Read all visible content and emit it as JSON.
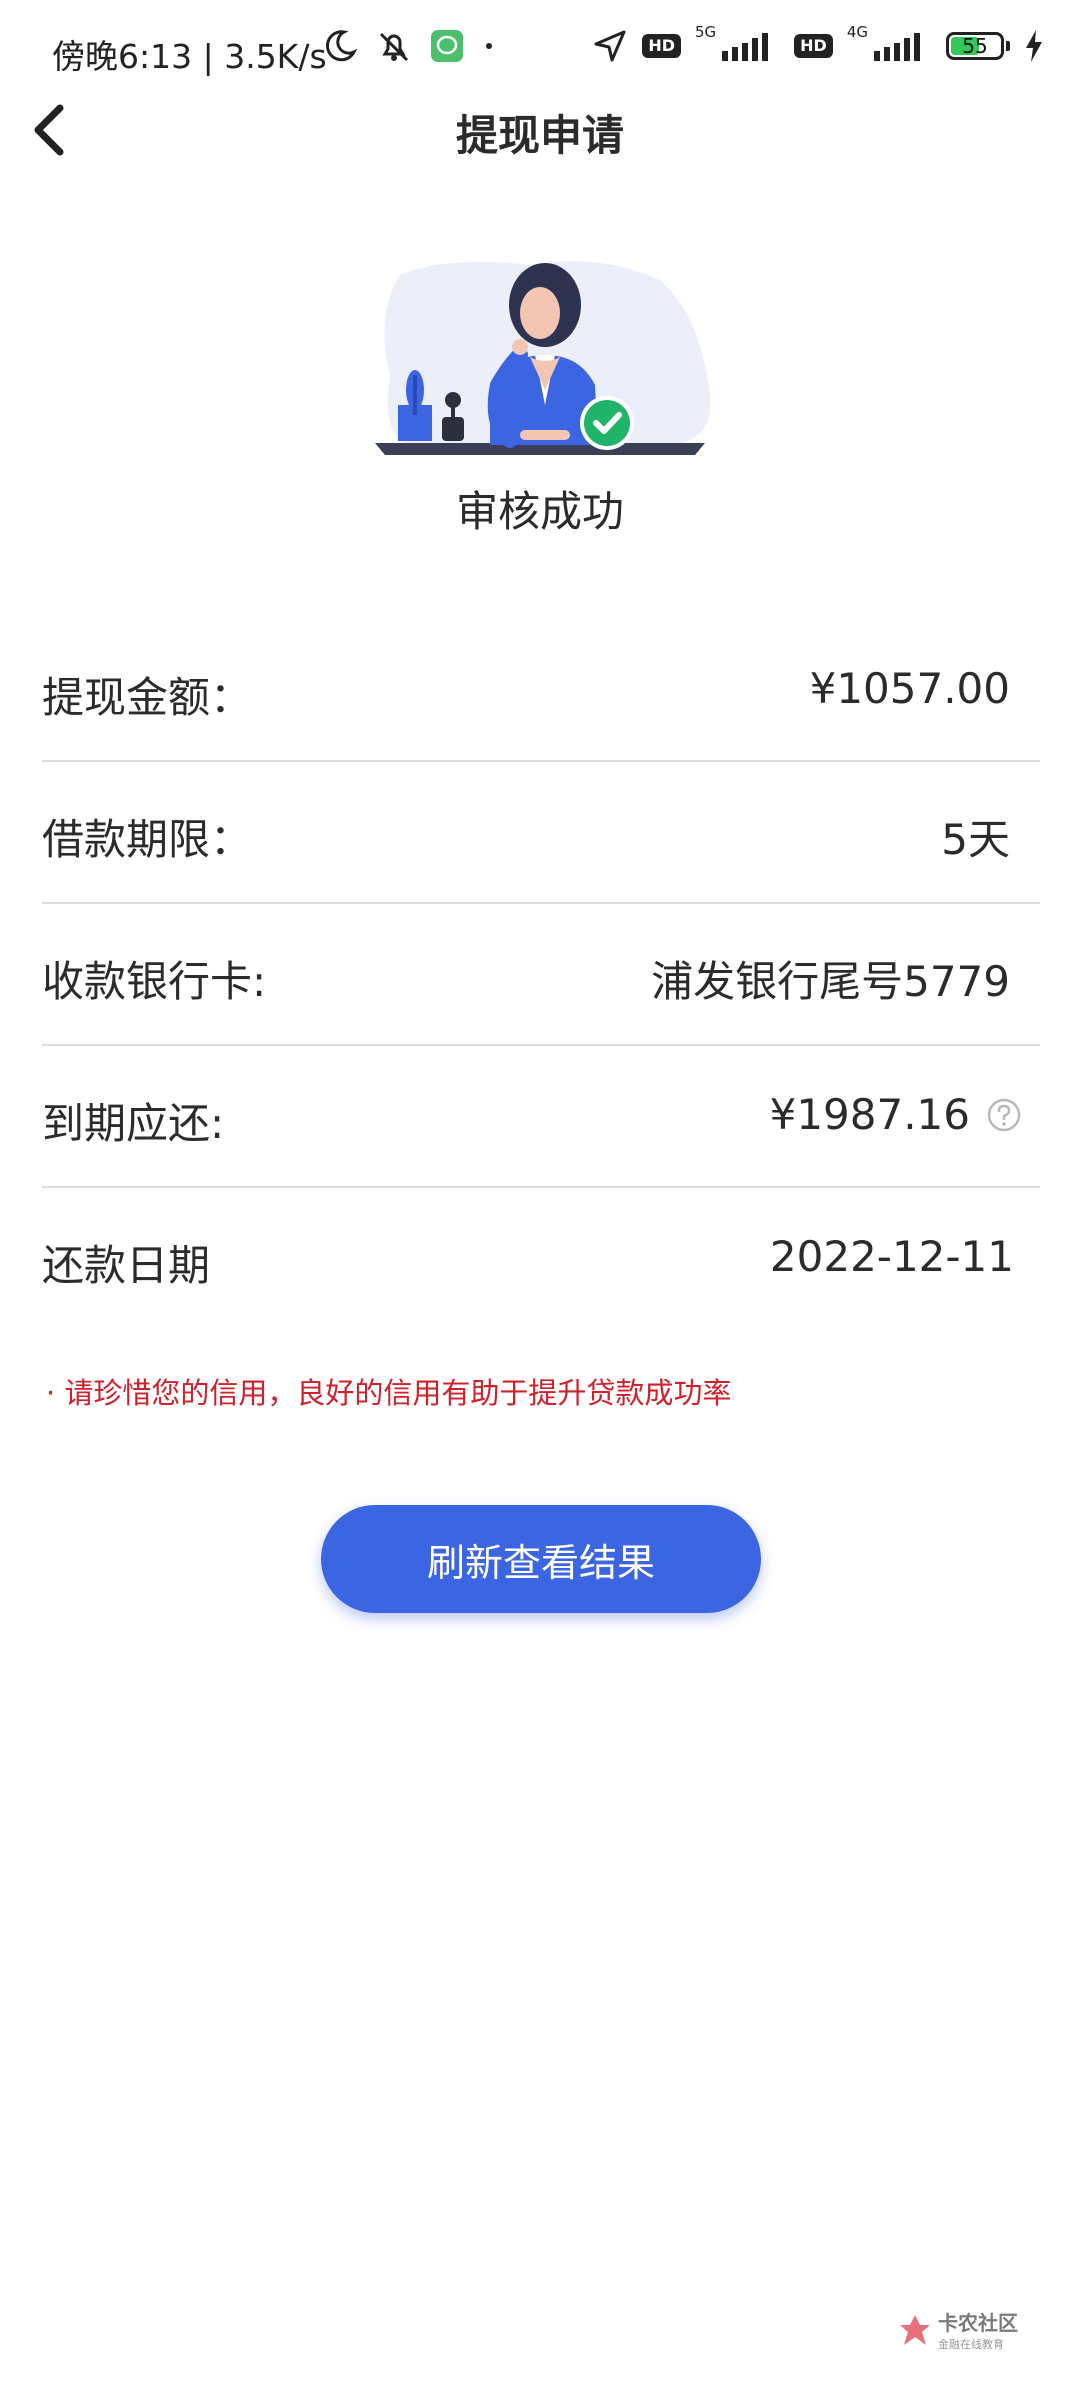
{
  "status_bar": {
    "time_text": "傍晚6:13 | 3.5K/s",
    "hd_label": "HD",
    "net1": "5G",
    "net2": "4G",
    "battery": "55"
  },
  "nav": {
    "title": "提现申请"
  },
  "result": {
    "title": "审核成功"
  },
  "info": {
    "rows": [
      {
        "label": "提现金额：",
        "value": "¥1057.00"
      },
      {
        "label": "借款期限：",
        "value": "5天"
      },
      {
        "label": "收款银行卡:",
        "value": "浦发银行尾号5779"
      },
      {
        "label": "到期应还:",
        "value": "¥1987.16"
      },
      {
        "label": "还款日期",
        "value": "2022-12-11"
      }
    ]
  },
  "notice": "· 请珍惜您的信用，良好的信用有助于提升贷款成功率",
  "button": {
    "label": "刷新查看结果"
  },
  "watermark": {
    "main": "卡农社区",
    "sub": "金融在线教育"
  },
  "colors": {
    "accent": "#3c65e2",
    "notice": "#d0202a",
    "success": "#1fb46a"
  }
}
